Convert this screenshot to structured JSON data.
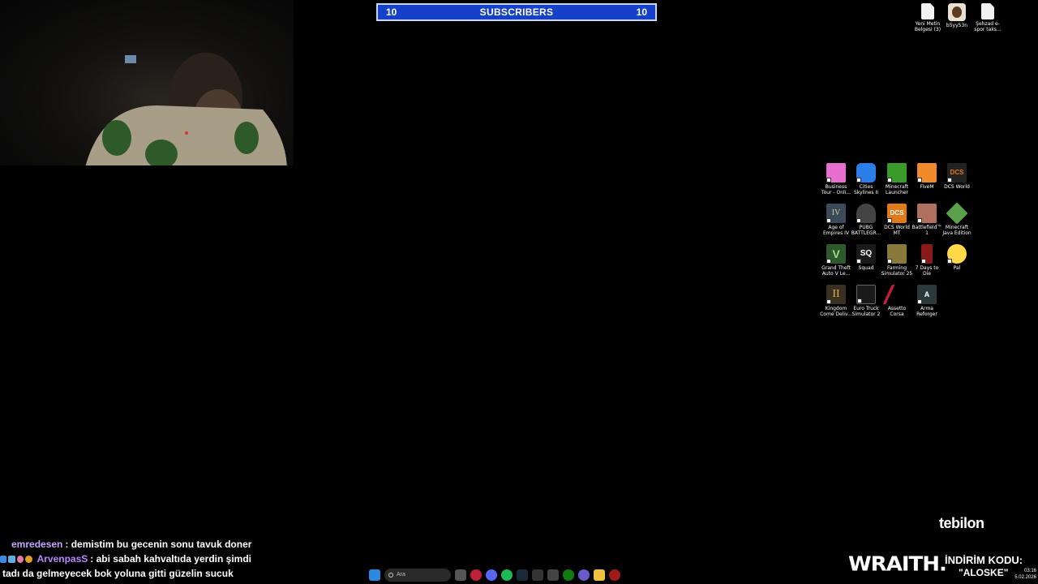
{
  "subscribers": {
    "left_count": "10",
    "title": "SUBSCRIBERS",
    "right_count": "10"
  },
  "top_files": [
    {
      "label": "Yeni Metin Belgesi (3)",
      "icon": "text-file-icon"
    },
    {
      "label": "b5yy53n",
      "icon": "portrait-image-icon"
    },
    {
      "label": "Şehzad e-spor taks...",
      "icon": "text-file-icon"
    }
  ],
  "desktop_icons": [
    {
      "label": "Business Tour - Onli...",
      "color": "#e86fd0"
    },
    {
      "label": "Cities Skylines II",
      "color": "#2b7de9"
    },
    {
      "label": "Minecraft Launcher",
      "color": "#3a9a2a"
    },
    {
      "label": "FiveM",
      "color": "#f08a2a"
    },
    {
      "label": "DCS World",
      "color": "#222222"
    },
    {
      "label": "Age of Empires IV",
      "color": "#3a4a5a"
    },
    {
      "label": "PUBG BATTLEGR...",
      "color": "#444444"
    },
    {
      "label": "DCS World MT",
      "color": "#e07a1a"
    },
    {
      "label": "Battlefield™ 1",
      "color": "#b07060"
    },
    {
      "label": "Minecraft Java Edition",
      "color": "#5aa04a"
    },
    {
      "label": "Grand Theft Auto V Le...",
      "color": "#2d5a2d"
    },
    {
      "label": "Squad",
      "color": "#1a1a1a"
    },
    {
      "label": "Farming Simulator 25",
      "color": "#8a7a3a"
    },
    {
      "label": "7 Days to Die",
      "color": "#8a1a1a"
    },
    {
      "label": "Pal",
      "color": "#ffd84a"
    },
    {
      "label": "Kingdom Come Deliv...",
      "color": "#3a3020"
    },
    {
      "label": "Euro Truck Simulator 2",
      "color": "#1a1a1a"
    },
    {
      "label": "Assetto Corsa",
      "color": "#c02030"
    },
    {
      "label": "Arma Reforger",
      "color": "#2a3a3a"
    }
  ],
  "chat": [
    {
      "user": "emredesen",
      "message": ": demistim bu gecenin sonu tavuk doner"
    },
    {
      "user": "ArvenpasS",
      "message": ": abi sabah kahvaltıda yerdin şimdi",
      "continuation": "tadı da gelmeyecek bok yoluna gitti güzelin sucuk"
    }
  ],
  "taskbar": {
    "search_placeholder": "Ara"
  },
  "clock": {
    "time": "03:16",
    "date": "5.02.2026"
  },
  "sponsor": {
    "tebilon": "tebilon",
    "wraith": "WRAITH.",
    "discount_label": "İNDİRİM KODU:",
    "discount_code": "\"ALOSKE\""
  }
}
